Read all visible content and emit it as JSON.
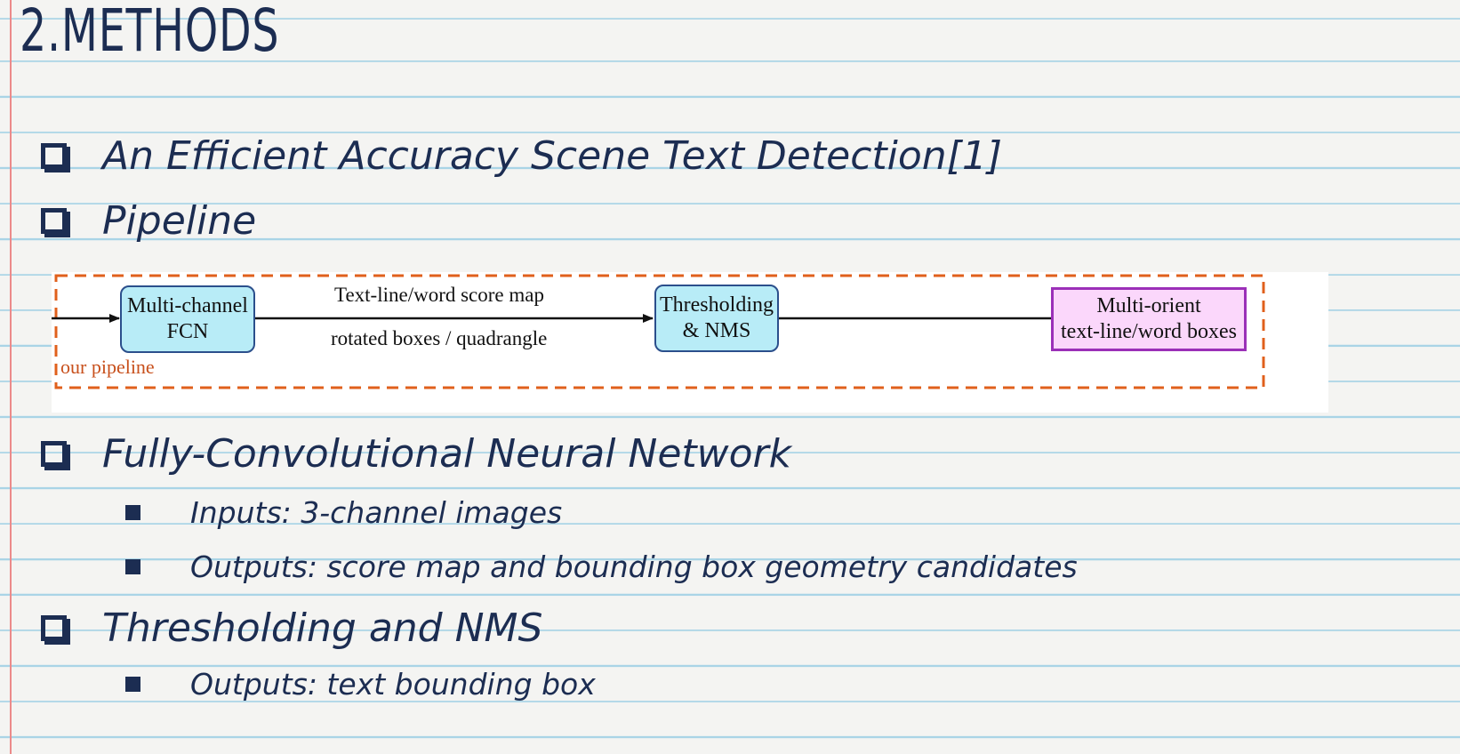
{
  "slide": {
    "title": "2.METHODS",
    "items": [
      {
        "type": "l1",
        "text": "An Efficient Accuracy Scene Text Detection[1]"
      },
      {
        "type": "l1",
        "text": "Pipeline"
      },
      {
        "type": "l1",
        "text": "Fully-Convolutional Neural Network"
      },
      {
        "type": "l2",
        "text": "Inputs: 3-channel  images"
      },
      {
        "type": "l2",
        "text": "Outputs: score map and bounding box geometry  candidates"
      },
      {
        "type": "l1",
        "text": "Thresholding and NMS"
      },
      {
        "type": "l2",
        "text": "Outputs: text bounding box"
      }
    ]
  },
  "diagram": {
    "node_fcn": {
      "line1": "Multi-channel",
      "line2": "FCN"
    },
    "edge_label_top": "Text-line/word score map",
    "edge_label_bottom": "rotated boxes / quadrangle",
    "node_nms": {
      "line1": "Thresholding",
      "line2": "& NMS"
    },
    "node_output": {
      "line1": "Multi-orient",
      "line2": "text-line/word boxes"
    },
    "pipeline_label": "our pipeline"
  },
  "colors": {
    "ink": "#1c2d52",
    "notebook_rule": "#a9d4e6",
    "margin_rule": "#ec8a8a",
    "pipeline_dash": "#e0601c",
    "node_fill": "#b8ecf7",
    "output_fill": "#fbd7fb",
    "output_border": "#9b30b8"
  },
  "icons": {
    "l1_bullet": "checkbox-icon",
    "l2_bullet": "square-bullet-icon"
  }
}
